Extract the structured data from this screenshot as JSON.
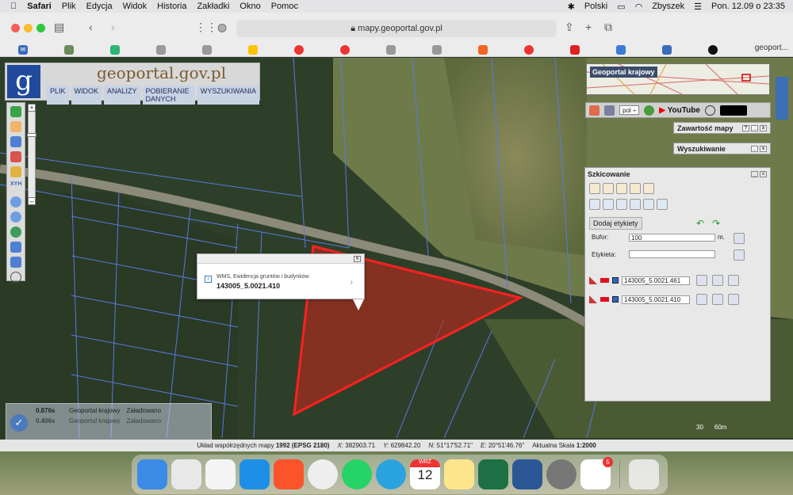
{
  "menubar": {
    "app": "Safari",
    "items": [
      "Plik",
      "Edycja",
      "Widok",
      "Historia",
      "Zakładki",
      "Okno",
      "Pomoc"
    ],
    "keyboard": "Polski",
    "user": "Zbyszek",
    "clock": "Pon. 12.09 o  23:35"
  },
  "browser": {
    "url": "mapy.geoportal.gov.pl",
    "last_tab": "geoport..."
  },
  "geoportal": {
    "logo_text": "geoportal.gov.pl",
    "logo_letter": "g",
    "menu": [
      "PLIK",
      "WIDOK",
      "ANALIZY",
      "POBIERANIE DANYCH",
      "WYSZUKIWANIA"
    ],
    "overview_label": "Geoportal krajowy",
    "lang": "pol ÷",
    "youtube": "YouTube",
    "panels": {
      "content": "Zawartość mapy",
      "search": "Wyszukiwanie"
    },
    "xyh_label": "XYH"
  },
  "popup": {
    "source": "WMS, Ewidencja gruntów i budynków",
    "parcel": "143005_5.0021.410",
    "info_icon": "i",
    "chevron": "›",
    "close": "x"
  },
  "sketch": {
    "title": "Szkicowanie",
    "add_labels": "Dodaj etykiety",
    "buffer_label": "Bufor:",
    "buffer_value": "100",
    "buffer_unit": "m.",
    "label_label": "Etykieta:",
    "features": [
      {
        "name": "143005_5.0021.461"
      },
      {
        "name": "143005_5.0021.410"
      }
    ]
  },
  "load_status": {
    "rows": [
      {
        "time": "0.876s",
        "service": "Geoportal krajowy",
        "state": "Załadowano"
      },
      {
        "time": "0.406s",
        "service": "Geoportal krajowy",
        "state": "Załadowano"
      }
    ]
  },
  "coords": {
    "system_label": "Układ współrzędnych mapy",
    "system": "1992 (EPSG 2180)",
    "x_label": "X:",
    "x": "382903.71",
    "y_label": "Y:",
    "y": "629842.20",
    "n_label": "N:",
    "n": "51°17'52.71\"",
    "e_label": "E:",
    "e": "20°51'46.76\"",
    "scale_label": "Aktualna Skala",
    "scale": "1:2000",
    "scalebar_left": "30",
    "scalebar_right": "60m"
  },
  "dock": {
    "calendar_month": "WRZ",
    "calendar_day": "12",
    "reminders_badge": "5"
  }
}
